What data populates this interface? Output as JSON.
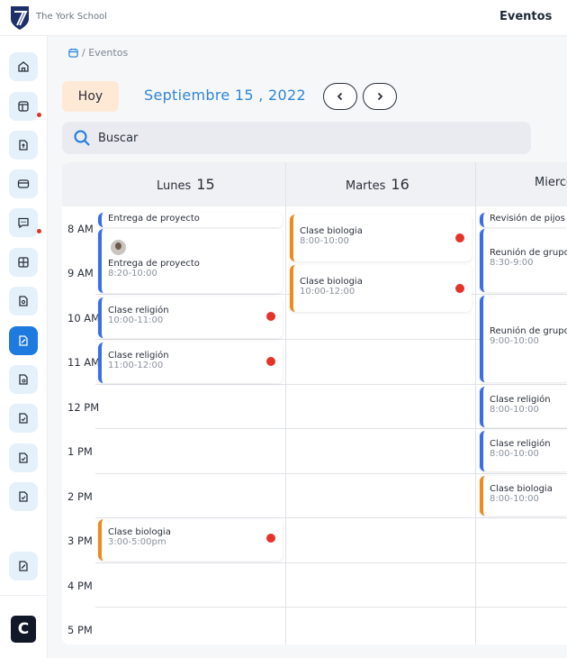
{
  "header": {
    "school_name": "The York School",
    "page_title": "Eventos"
  },
  "breadcrumb": {
    "current": "/ Eventos"
  },
  "toolbar": {
    "today_label": "Hoy",
    "date_title": "Septiembre 15 , 2022"
  },
  "search": {
    "placeholder": "Buscar"
  },
  "calendar": {
    "days": [
      {
        "name": "Lunes",
        "num": "15"
      },
      {
        "name": "Martes",
        "num": "16"
      },
      {
        "name": "Mierco",
        "num": ""
      }
    ],
    "times": [
      "8 AM",
      "9 AM",
      "10 AM",
      "11 AM",
      "12 PM",
      "1 PM",
      "2 PM",
      "3 PM",
      "4 PM",
      "5 PM"
    ],
    "events": {
      "mon": [
        {
          "title": "Entrega de proyecto",
          "time": ""
        },
        {
          "title": "Entrega de proyecto",
          "time": "8:20-10:00"
        },
        {
          "title": "Clase religión",
          "time": "10:00-11:00"
        },
        {
          "title": "Clase religión",
          "time": "11:00-12:00"
        },
        {
          "title": "Clase biologia",
          "time": "3:00-5:00pm"
        }
      ],
      "tue": [
        {
          "title": "Clase biologia",
          "time": "8:00-10:00"
        },
        {
          "title": "Clase biologia",
          "time": "10:00-12:00"
        }
      ],
      "wed": [
        {
          "title": "Revisión de pijos",
          "time": ""
        },
        {
          "title": "Reunión de grupo",
          "time": "8:30-9:00"
        },
        {
          "title": "Reunión de grupo",
          "time": "9:00-10:00"
        },
        {
          "title": "Clase religión",
          "time": "8:00-10:00"
        },
        {
          "title": "Clase religión",
          "time": "8:00-10:00"
        },
        {
          "title": "Clase biologia",
          "time": "8:00-10:00"
        }
      ]
    }
  },
  "colors": {
    "accent": "#1f7ae0",
    "blue_event": "#3a6ee8",
    "orange_event": "#f08a1c",
    "alert": "#e5332a",
    "today_bg": "#fde9d6"
  },
  "sidebar_icons": [
    "home-icon",
    "layout-icon",
    "document-upload-icon",
    "card-icon",
    "chat-icon",
    "grid-icon",
    "document-search-icon",
    "document-edit-icon",
    "document-settings-icon",
    "document-check-icon",
    "document-check-icon",
    "document-check-icon",
    "document-edit-icon"
  ]
}
